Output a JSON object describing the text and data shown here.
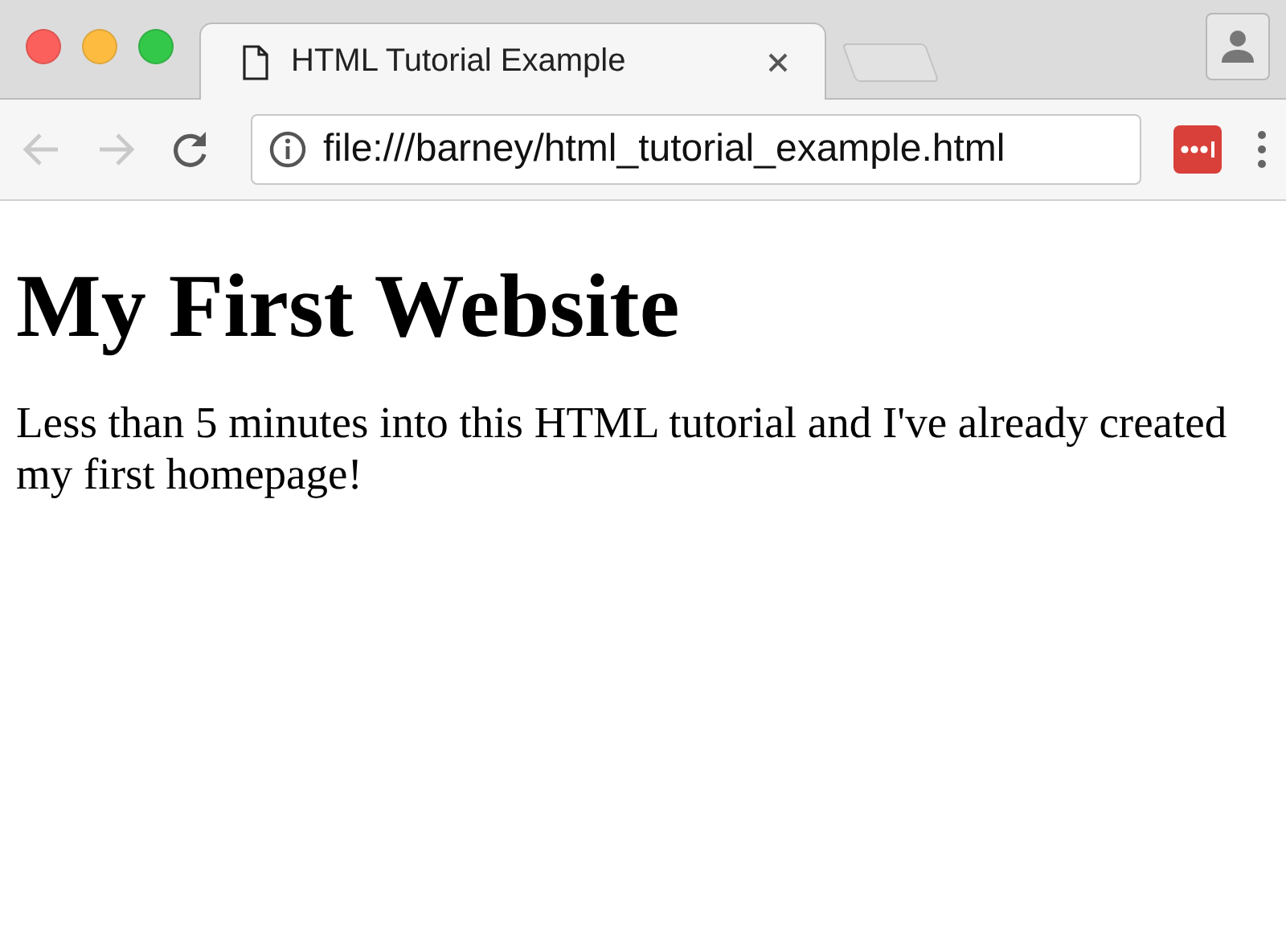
{
  "window": {
    "controls": [
      {
        "color": "#fc605c"
      },
      {
        "color": "#fdbc40"
      },
      {
        "color": "#34c84a"
      }
    ]
  },
  "tabs": [
    {
      "title": "HTML Tutorial Example",
      "selected": true
    }
  ],
  "toolbar": {
    "back": {
      "disabled": true
    },
    "forward": {
      "disabled": true
    },
    "address": "file:///barney/html_tutorial_example.html"
  },
  "page": {
    "heading": "My First Website",
    "paragraph": "Less than 5 minutes into this HTML tutorial and I've already created my first homepage!"
  }
}
